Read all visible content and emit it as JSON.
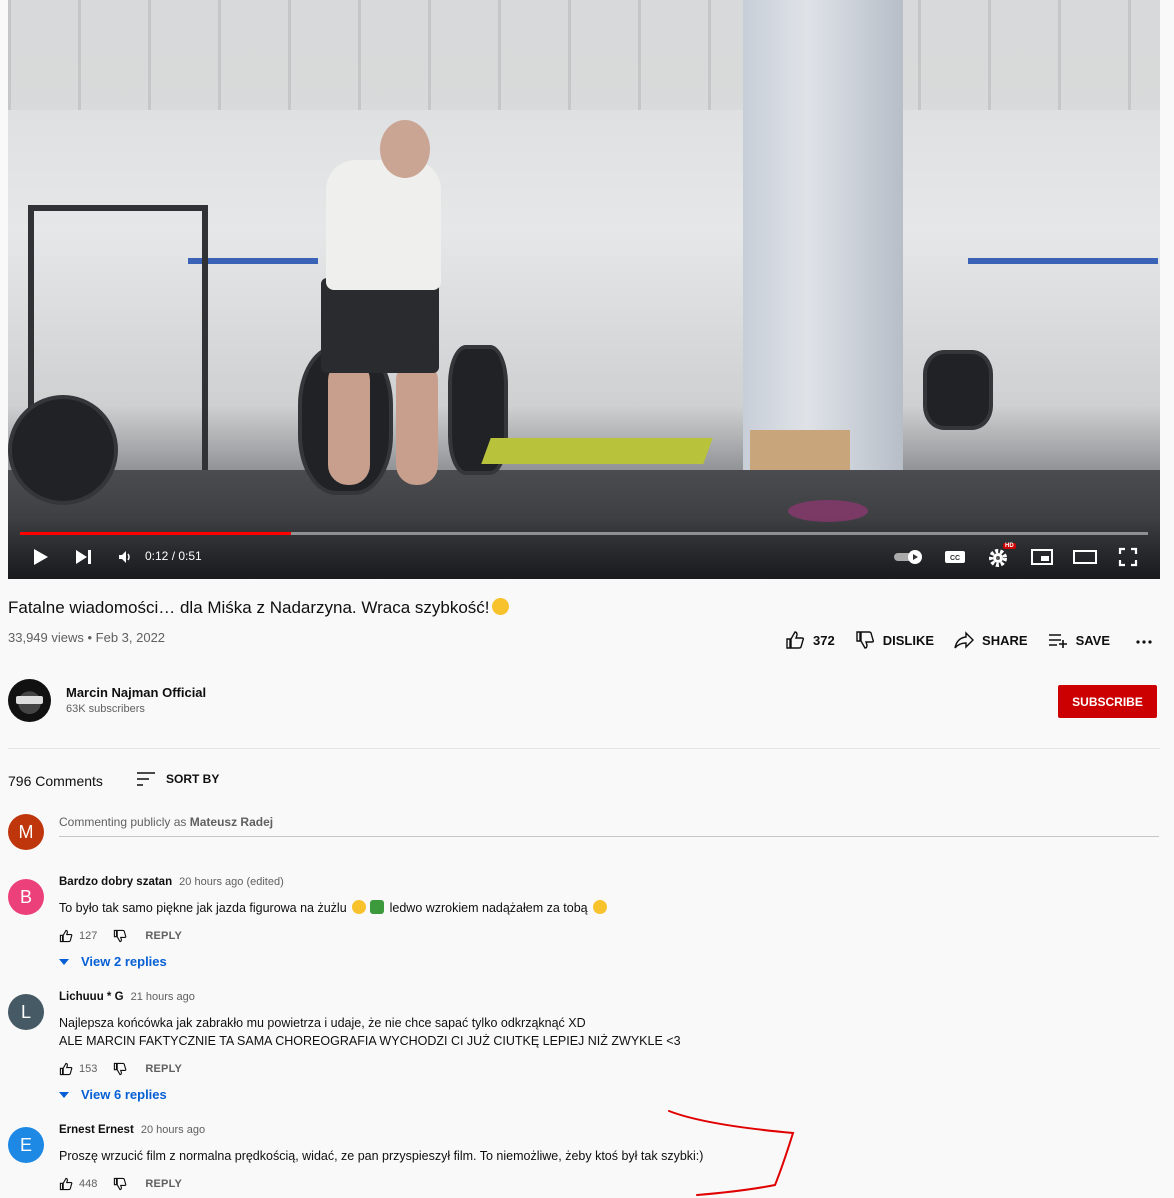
{
  "player": {
    "time_display": "0:12 / 0:51",
    "progress_fraction": 0.24,
    "hd_badge": "HD",
    "cc_label": "CC",
    "accent_color": "#ff0000"
  },
  "video": {
    "title": "Fatalne wiadomości… dla Miśka z Nadarzyna. Wraca szybkość!",
    "meta": "33,949 views • Feb 3, 2022",
    "likes": "372",
    "dislike_label": "DISLIKE",
    "share_label": "SHARE",
    "save_label": "SAVE"
  },
  "channel": {
    "name": "Marcin Najman Official",
    "subscribers": "63K subscribers",
    "subscribe_label": "SUBSCRIBE",
    "subscribe_color": "#cc0000"
  },
  "comments_header": {
    "count": "796 Comments",
    "sort_label": "SORT BY"
  },
  "composer": {
    "avatar_letter": "M",
    "avatar_color": "#bf360c",
    "prefix": "Commenting publicly as",
    "user": "Mateusz Radej"
  },
  "comments": [
    {
      "avatar_letter": "B",
      "avatar_color": "#ec407a",
      "author": "Bardzo dobry szatan",
      "time": "20 hours ago (edited)",
      "text_parts": [
        "To było tak samo piękne jak jazda figurowa na żużlu ",
        " ledwo wzrokiem  nadążałem za tobą "
      ],
      "likes": "127",
      "reply_label": "REPLY",
      "view_replies": "View 2 replies"
    },
    {
      "avatar_letter": "L",
      "avatar_color": "#455a64",
      "author": "Lichuuu * G",
      "time": "21 hours ago",
      "lines": [
        "Najlepsza końcówka jak zabrakło mu powietrza i udaje, że nie chce sapać tylko odkrząknąć XD",
        "ALE MARCIN FAKTYCZNIE TA SAMA CHOREOGRAFIA WYCHODZI CI JUŻ CIUTKĘ LEPIEJ NIŻ ZWYKLE <3"
      ],
      "likes": "153",
      "reply_label": "REPLY",
      "view_replies": "View 6 replies"
    },
    {
      "avatar_letter": "E",
      "avatar_color": "#1e88e5",
      "author": "Ernest Ernest",
      "time": "20 hours ago",
      "text": "Proszę wrzucić film z normalna prędkością, widać, ze pan przyspieszył film. To niemożliwe, żeby ktoś był tak szybki:)",
      "likes": "448",
      "reply_label": "REPLY"
    }
  ],
  "link_color": "#065fd4",
  "annotation_color": "#e00000"
}
